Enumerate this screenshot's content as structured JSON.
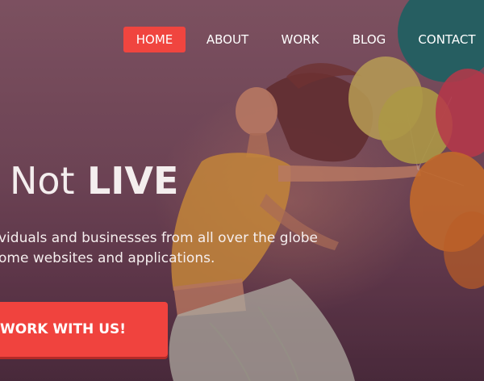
{
  "nav": {
    "items": [
      {
        "label": "HOME",
        "active": true
      },
      {
        "label": "ABOUT",
        "active": false
      },
      {
        "label": "WORK",
        "active": false
      },
      {
        "label": "BLOG",
        "active": false
      },
      {
        "label": "CONTACT",
        "active": false
      }
    ],
    "accent": "#f0453f"
  },
  "hero": {
    "headline_not": "Not",
    "headline_live": "LIVE",
    "sub_line_1": "viduals and businesses from all over the globe",
    "sub_line_2": "ome websites and applications.",
    "cta_label": "WORK WITH US!"
  },
  "colors": {
    "cta": "#f0433e",
    "text": "#ffffff"
  }
}
